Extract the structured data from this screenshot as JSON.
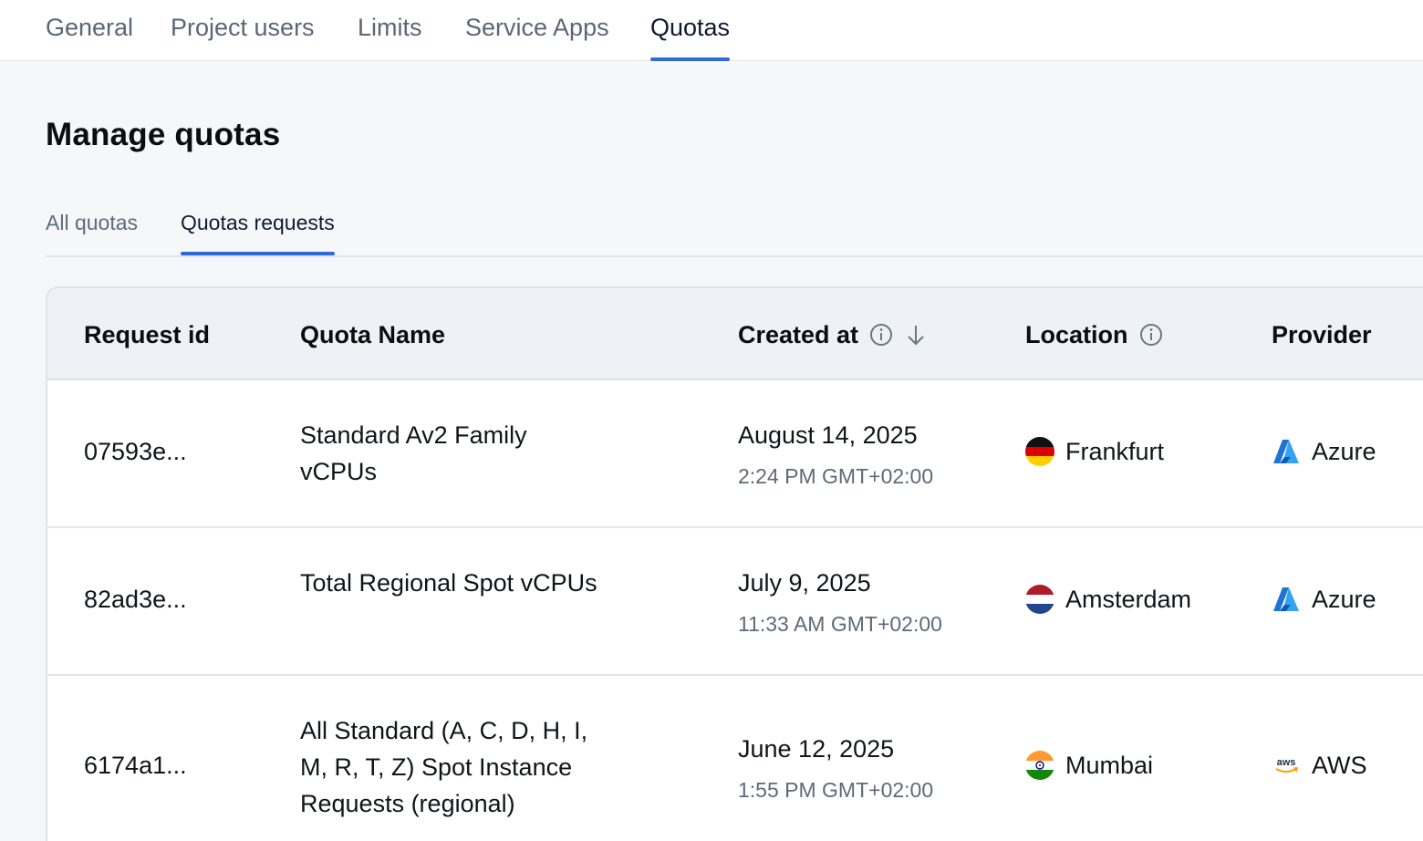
{
  "top_tabs": [
    {
      "label": "General"
    },
    {
      "label": "Project users"
    },
    {
      "label": "Limits"
    },
    {
      "label": "Service Apps"
    },
    {
      "label": "Quotas",
      "active": true
    }
  ],
  "page_title": "Manage quotas",
  "sub_tabs": [
    {
      "label": "All quotas"
    },
    {
      "label": "Quotas requests",
      "active": true
    }
  ],
  "table": {
    "headers": {
      "request_id": "Request id",
      "quota_name": "Quota Name",
      "created_at": "Created at",
      "location": "Location",
      "provider": "Provider"
    },
    "rows": [
      {
        "request_id": "07593e...",
        "quota_name": "Standard Av2 Family vCPUs",
        "date": "August 14, 2025",
        "time": "2:24 PM GMT+02:00",
        "location": "Frankfurt",
        "flag": "germany-flag-icon",
        "provider": "Azure",
        "provider_icon": "azure-logo-icon"
      },
      {
        "request_id": "82ad3e...",
        "quota_name": "Total Regional Spot vCPUs",
        "date": "July 9, 2025",
        "time": "11:33 AM GMT+02:00",
        "location": "Amsterdam",
        "flag": "netherlands-flag-icon",
        "provider": "Azure",
        "provider_icon": "azure-logo-icon"
      },
      {
        "request_id": "6174a1...",
        "quota_name": "All Standard (A, C, D, H, I, M, R, T, Z) Spot Instance Requests (regional)",
        "date": "June 12, 2025",
        "time": "1:55 PM GMT+02:00",
        "location": "Mumbai",
        "flag": "india-flag-icon",
        "provider": "AWS",
        "provider_icon": "aws-logo-icon",
        "aws_logo_text": "aws"
      }
    ]
  },
  "colors": {
    "accent": "#2f6ad9",
    "header_bg": "#eef1f5",
    "page_bg": "#f6f7f9"
  }
}
